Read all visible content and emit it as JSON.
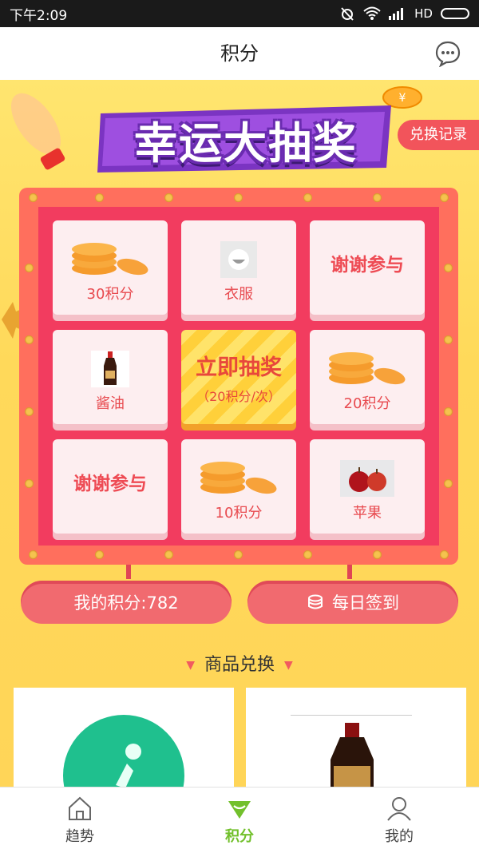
{
  "status": {
    "time": "下午2:09",
    "network": "HD"
  },
  "header": {
    "title": "积分",
    "chat_icon": "chat-bubble-icon"
  },
  "lottery": {
    "banner": "幸运大抽奖",
    "record_button": "兑换记录",
    "prizes": [
      {
        "label": "30积分",
        "type": "coins"
      },
      {
        "label": "衣服",
        "type": "image"
      },
      {
        "label": "谢谢参与",
        "type": "thanks"
      },
      {
        "label": "酱油",
        "type": "image"
      },
      {
        "label": "20积分",
        "type": "coins"
      },
      {
        "label": "谢谢参与",
        "type": "thanks"
      },
      {
        "label": "10积分",
        "type": "coins"
      },
      {
        "label": "苹果",
        "type": "image"
      }
    ],
    "draw_button": "立即抽奖",
    "draw_cost": "（20积分/次）",
    "my_points": "我的积分:782",
    "sign_in": "每日签到"
  },
  "exchange": {
    "title": "商品兑换"
  },
  "tabs": [
    {
      "label": "趋势",
      "icon": "home-icon",
      "active": false
    },
    {
      "label": "积分",
      "icon": "gem-icon",
      "active": true
    },
    {
      "label": "我的",
      "icon": "user-icon",
      "active": false
    }
  ],
  "colors": {
    "accent": "#72c02c",
    "primary_red": "#f23c5f",
    "banner_purple": "#6a2bb0"
  }
}
